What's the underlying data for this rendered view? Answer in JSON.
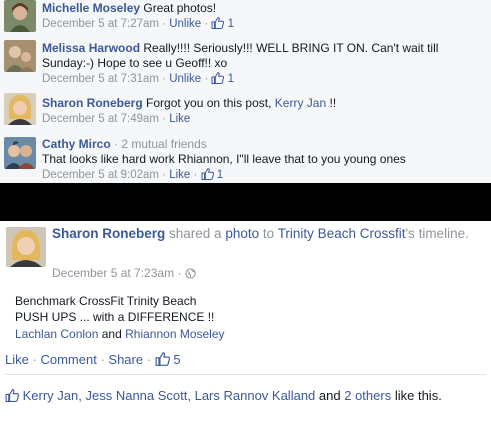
{
  "comments": [
    {
      "author": "Michelle Moseley",
      "text": "Great photos!",
      "time": "December 5 at 7:27am",
      "action": "Unlike",
      "likes": "1"
    },
    {
      "author": "Melissa Harwood",
      "text": "Really!!!! Seriously!!! WELL BRING IT ON. Can't wait till Sunday:-) Hope to see u Geoff!! xo",
      "time": "December 5 at 7:31am",
      "action": "Unlike",
      "likes": "1"
    },
    {
      "author": "Sharon Roneberg",
      "text_before": "Forgot you on this post,",
      "mention": "Kerry Jan",
      "text_after": "!!",
      "time": "December 5 at 7:49am",
      "action": "Like"
    },
    {
      "author": "Cathy Mirco",
      "mutual": "2 mutual friends",
      "text": "That looks like hard work Rhiannon, I\"ll leave that to you young ones",
      "time": "December 5 at 9:02am",
      "action": "Like",
      "likes": "1"
    }
  ],
  "separator": "·",
  "post": {
    "author": "Sharon Roneberg",
    "shared_text": "shared a",
    "photo_link": "photo",
    "to_text": "to",
    "page_name": "Trinity Beach Crossfit",
    "timeline_suffix": "'s timeline.",
    "time": "December 5 at 7:23am",
    "body_line1": "Benchmark CrossFit Trinity Beach",
    "body_line2": "PUSH UPS ... with a DIFFERENCE !!",
    "tag1": "Lachlan Conlon",
    "tag_and": "and",
    "tag2": "Rhiannon Moseley",
    "action_like": "Like",
    "action_comment": "Comment",
    "action_share": "Share",
    "like_count": "5",
    "likers": {
      "names": "Kerry Jan, Jess Nanna Scott, Lars Rannov Kalland",
      "and": "and",
      "others": "2 others",
      "suffix": "like this."
    }
  },
  "colors": {
    "link": "#3b5998",
    "meta": "#90949c",
    "text": "#141823",
    "band": "#000000"
  }
}
